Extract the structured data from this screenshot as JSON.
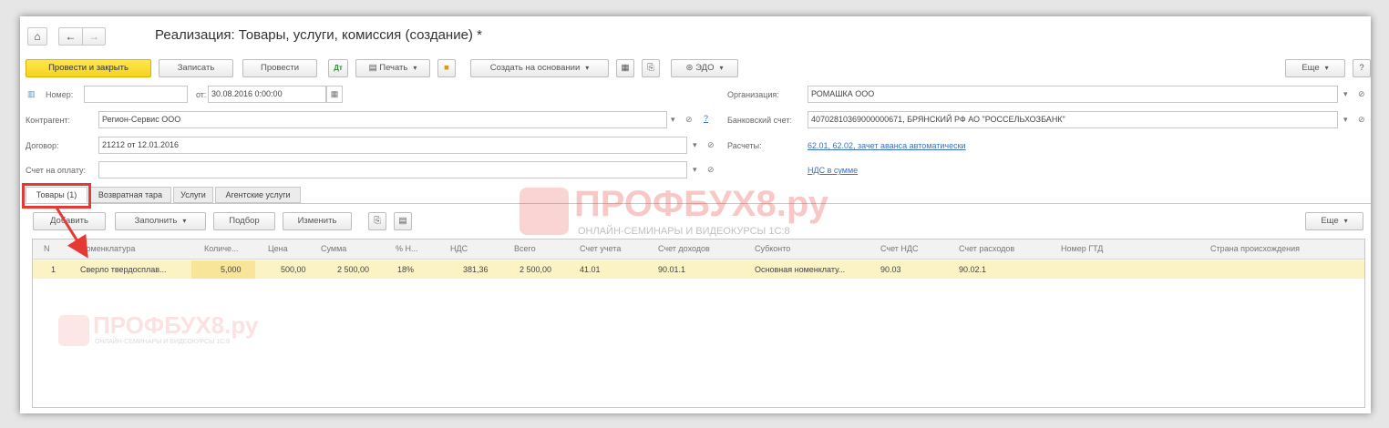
{
  "window": {
    "title": "Реализация: Товары, услуги, комиссия (создание) *",
    "nav": {
      "home": "⌂",
      "back": "←",
      "forward": "→"
    }
  },
  "toolbar": {
    "post_close": "Провести и закрыть",
    "save": "Записать",
    "post": "Провести",
    "print": "Печать",
    "create_based": "Создать на основании",
    "edo": "ЭДО",
    "more": "Еще",
    "help": "?"
  },
  "form": {
    "number_label": "Номер:",
    "number_value": "",
    "date_label": "от:",
    "date_value": "30.08.2016 0:00:00",
    "org_label": "Организация:",
    "org_value": "РОМАШКА ООО",
    "contractor_label": "Контрагент:",
    "contractor_value": "Регион-Сервис ООО",
    "bank_label": "Банковский счет:",
    "bank_value": "40702810369000000671, БРЯНСКИЙ РФ АО \"РОССЕЛЬХОЗБАНК\"",
    "contract_label": "Договор:",
    "contract_value": "21212 от 12.01.2016",
    "settlements_label": "Расчеты:",
    "settlements_link": "62.01, 62.02, зачет аванса автоматически",
    "invoice_label": "Счет на оплату:",
    "invoice_value": "",
    "vat_link": "НДС в сумме"
  },
  "tabs": [
    {
      "label": "Товары (1)"
    },
    {
      "label": "Возвратная тара"
    },
    {
      "label": "Услуги"
    },
    {
      "label": "Агентские услуги"
    }
  ],
  "grid_toolbar": {
    "add": "Добавить",
    "fill": "Заполнить",
    "select": "Подбор",
    "change": "Изменить",
    "more": "Еще"
  },
  "table": {
    "headers": [
      "N",
      "Номенклатура",
      "Количе...",
      "Цена",
      "Сумма",
      "% Н...",
      "НДС",
      "Всего",
      "Счет учета",
      "Счет доходов",
      "Субконто",
      "Счет НДС",
      "Счет расходов",
      "Номер ГТД",
      "Страна происхождения"
    ],
    "rows": [
      [
        "1",
        "Сверло твердосплав...",
        "5,000",
        "500,00",
        "2 500,00",
        "18%",
        "381,36",
        "2 500,00",
        "41.01",
        "90.01.1",
        "Основная номенклату...",
        "90.03",
        "90.02.1",
        "",
        ""
      ]
    ]
  },
  "watermark": {
    "brand": "ПРОФБУХ8.ру",
    "tagline": "ОНЛАЙН-СЕМИНАРЫ И ВИДЕОКУРСЫ 1С:8"
  },
  "colors": {
    "primary_button": "#f7d21f",
    "selected_row": "#fbf3c4",
    "highlight": "#e53935",
    "link": "#3a6fc4"
  }
}
